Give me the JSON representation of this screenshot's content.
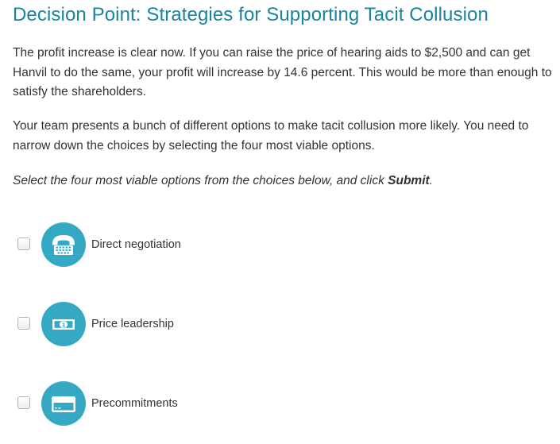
{
  "title": "Decision Point: Strategies for Supporting Tacit Collusion",
  "paragraphs": [
    "The profit increase is clear now. If you can raise the price of hearing aids to $2,500 and can get Hanvil to do the same, your profit will increase by 14.6 percent. This would be more than enough to satisfy the shareholders.",
    "Your team presents a bunch of different options to make tacit collusion more likely. You need to narrow down the choices by selecting the four most viable options."
  ],
  "instruction": {
    "before": "Select the four most viable options from the choices below, and click ",
    "bold": "Submit",
    "after": "."
  },
  "options": [
    {
      "label": "Direct negotiation",
      "icon": "telephone-icon",
      "checked": false
    },
    {
      "label": "Price leadership",
      "icon": "banknote-icon",
      "checked": false
    },
    {
      "label": "Precommitments",
      "icon": "credit-card-icon",
      "checked": false
    }
  ],
  "colors": {
    "title": "#1a84a0",
    "icon_circle": "#35a9c4",
    "text": "#333333"
  }
}
